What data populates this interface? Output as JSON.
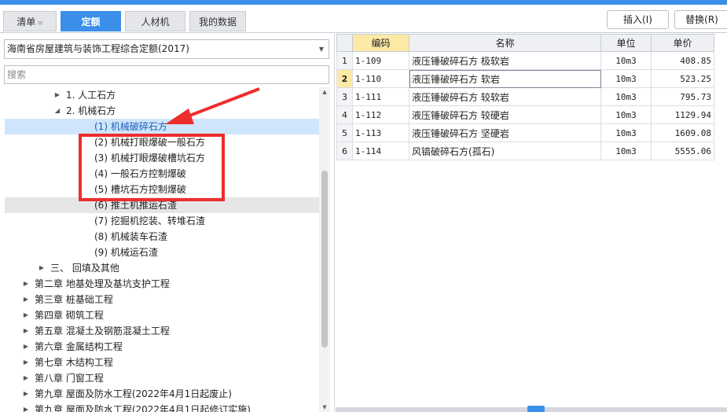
{
  "tabs": [
    {
      "label": "清单",
      "has_arrow": true
    },
    {
      "label": "定额",
      "active": true
    },
    {
      "label": "人材机"
    },
    {
      "label": "我的数据"
    }
  ],
  "tab_arrow": "≡",
  "buttons": {
    "insert": "插入(I)",
    "replace": "替换(R)"
  },
  "library": {
    "selected": "海南省房屋建筑与装饰工程综合定额(2017)"
  },
  "search": {
    "placeholder": "搜索"
  },
  "tree": [
    {
      "label": "1. 人工石方",
      "expanded": false
    },
    {
      "label": "2. 机械石方",
      "expanded": true
    },
    {
      "label": "(1) 机械破碎石方",
      "selected": true
    },
    {
      "label": "(2) 机械打眼爆破一般石方"
    },
    {
      "label": "(3) 机械打眼爆破槽坑石方"
    },
    {
      "label": "(4) 一般石方控制爆破"
    },
    {
      "label": "(5) 槽坑石方控制爆破"
    },
    {
      "label": "(6) 推土机推运石渣",
      "highlight": true
    },
    {
      "label": "(7) 挖掘机挖装、转堆石渣"
    },
    {
      "label": "(8) 机械装车石渣"
    },
    {
      "label": "(9) 机械运石渣"
    },
    {
      "label": "三、 回填及其他",
      "expanded": false
    },
    {
      "label": "第二章 地基处理及基坑支护工程",
      "expanded": false
    },
    {
      "label": "第三章 桩基础工程",
      "expanded": false
    },
    {
      "label": "第四章 砌筑工程",
      "expanded": false
    },
    {
      "label": "第五章 混凝土及钢筋混凝土工程",
      "expanded": false
    },
    {
      "label": "第六章 金属结构工程",
      "expanded": false
    },
    {
      "label": "第七章 木结构工程",
      "expanded": false
    },
    {
      "label": "第八章 门窗工程",
      "expanded": false
    },
    {
      "label": "第九章 屋面及防水工程(2022年4月1日起废止)",
      "expanded": false
    },
    {
      "label": "第九章 屋面及防水工程(2022年4月1日起修订实施)",
      "expanded": false
    }
  ],
  "table": {
    "headers": [
      "编码",
      "名称",
      "单位",
      "单价"
    ],
    "rows": [
      {
        "no": "1",
        "code": "1-109",
        "name": "液压锤破碎石方 极软岩",
        "unit": "10m3",
        "price": "408.85"
      },
      {
        "no": "2",
        "code": "1-110",
        "name": "液压锤破碎石方 软岩",
        "unit": "10m3",
        "price": "523.25",
        "current": true
      },
      {
        "no": "3",
        "code": "1-111",
        "name": "液压锤破碎石方 较软岩",
        "unit": "10m3",
        "price": "795.73"
      },
      {
        "no": "4",
        "code": "1-112",
        "name": "液压锤破碎石方 较硬岩",
        "unit": "10m3",
        "price": "1129.94"
      },
      {
        "no": "5",
        "code": "1-113",
        "name": "液压锤破碎石方 坚硬岩",
        "unit": "10m3",
        "price": "1609.08"
      },
      {
        "no": "6",
        "code": "1-114",
        "name": "风镐破碎石方(孤石)",
        "unit": "10m3",
        "price": "5555.06"
      }
    ]
  },
  "colors": {
    "accent": "#3b8fe8",
    "annotation": "#ee2d2d",
    "selected_row": "#cfe5fb",
    "header_highlight": "#fde9a6"
  }
}
